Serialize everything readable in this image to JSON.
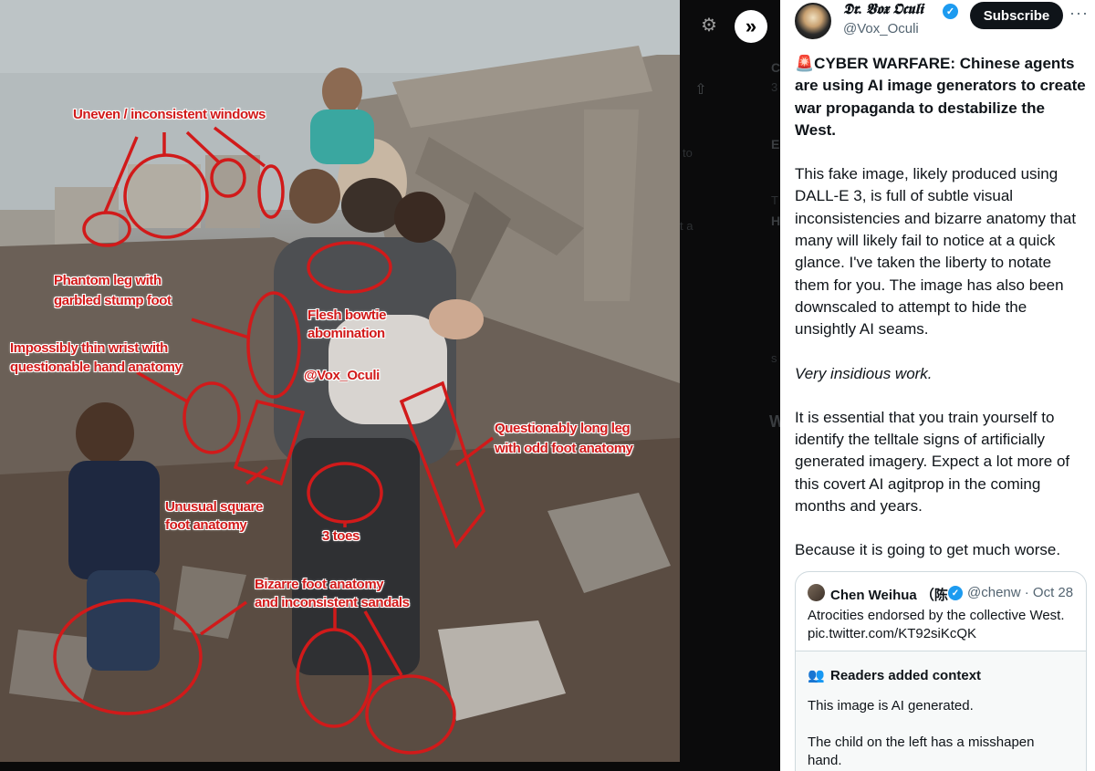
{
  "viewer": {
    "settings_icon": "gear-icon",
    "collapse_icon": "double-chevron-right-icon",
    "annotations": [
      "Uneven / inconsistent windows",
      "Phantom leg with",
      "garbled stump foot",
      "Flesh bowtie",
      "abomination",
      "Impossibly thin wrist with",
      "questionable hand anatomy",
      "@Vox_Oculi",
      "Questionably long leg",
      "with odd foot anatomy",
      "Unusual square",
      "foot anatomy",
      "3 toes",
      "Bizarre foot anatomy",
      "and inconsistent sandals"
    ],
    "annotation_color": "#d11a1a"
  },
  "background_timeline": {
    "fragments": [
      "C",
      "3",
      "E",
      "to",
      "T",
      "H",
      "t a",
      "s",
      "W"
    ]
  },
  "tweet": {
    "author": {
      "display_name": "𝕯𝖗. 𝖁𝖔𝖝 𝕺𝖈𝖚𝖑𝖎",
      "handle": "@Vox_Oculi",
      "verified": true
    },
    "subscribe_label": "Subscribe",
    "more_label": "···",
    "headline": "🚨CYBER WARFARE: Chinese agents are using AI image generators to create war propaganda to destabilize the West.",
    "paragraph_1": "This fake image, likely produced using DALL-E 3, is full of subtle visual inconsistencies and bizarre anatomy that many will likely fail to notice at a quick glance. I've taken the liberty to notate them for you. The image has also been downscaled to attempt to hide the unsightly AI seams.",
    "paragraph_2": "Very insidious work.",
    "paragraph_3": "It is essential that you train yourself to identify the telltale signs of artificially generated imagery. Expect a lot more of this covert AI agitprop in the coming months and years.",
    "paragraph_4": "Because it is going to get much worse."
  },
  "quote": {
    "name": "Chen Weihua （陈",
    "meta": "@chenw · Oct 28",
    "text": "Atrocities endorsed by the collective West. pic.twitter.com/KT92siKcQK",
    "community_notes": {
      "title": "Readers added context",
      "p1": "This image is AI generated.",
      "p2": "The child on the left has a misshapen hand."
    }
  },
  "colors": {
    "accent": "#1d9bf0",
    "text": "#0f1419",
    "muted": "#536471"
  }
}
